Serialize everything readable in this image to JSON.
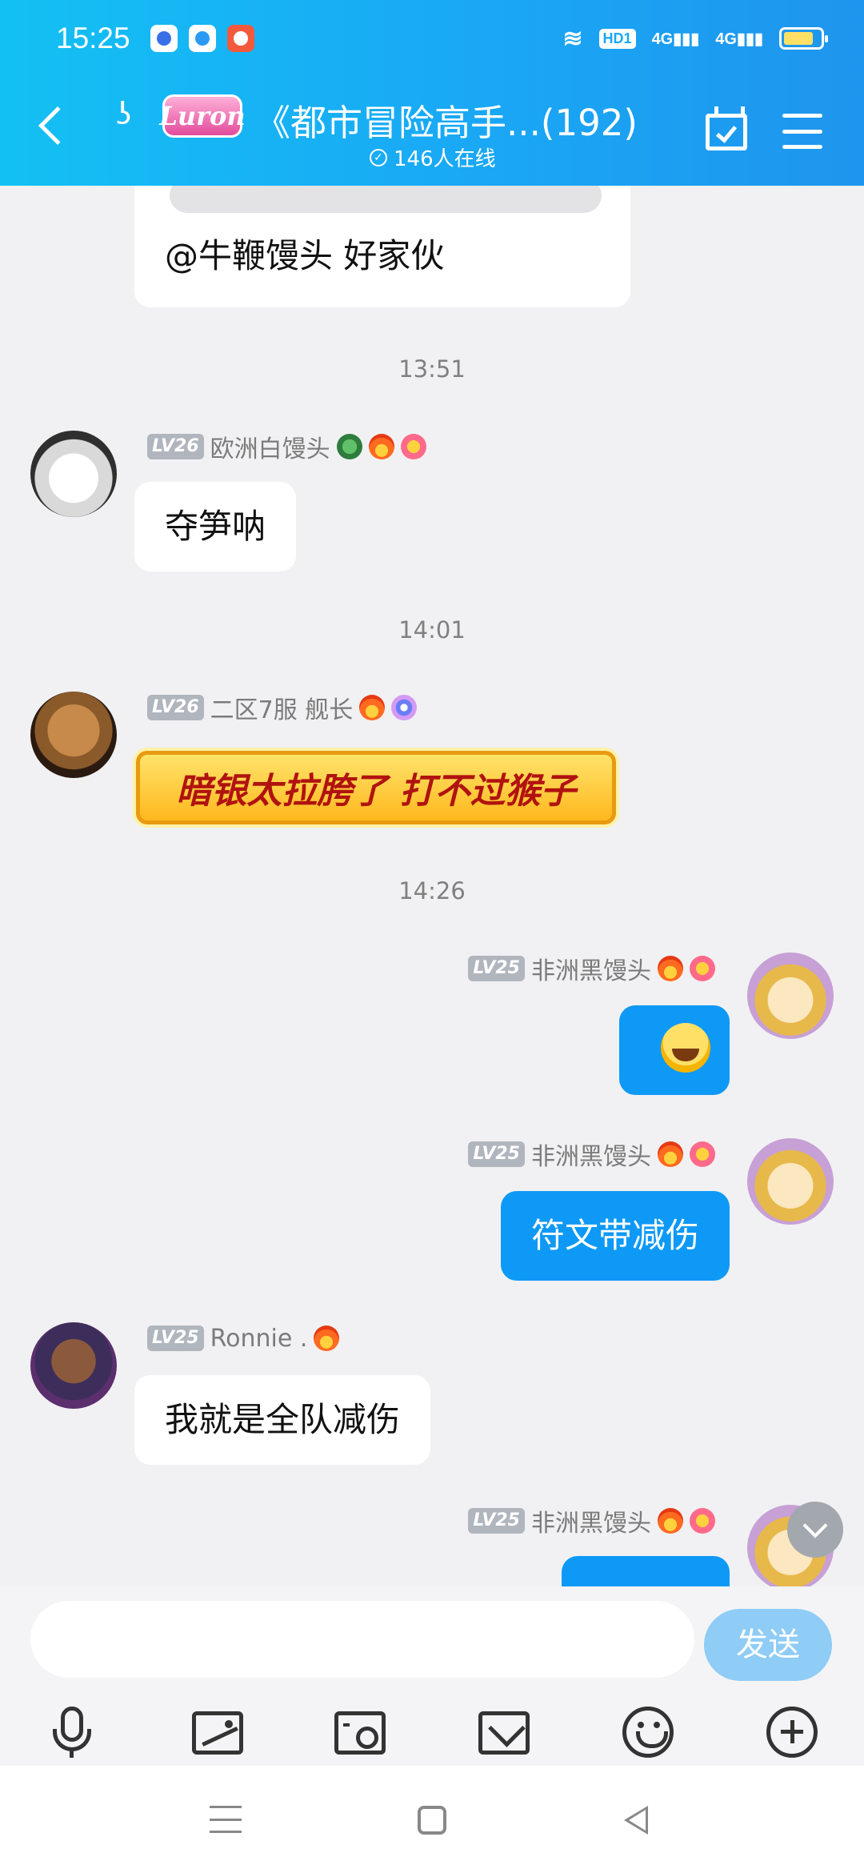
{
  "status_bar": {
    "time": "15:25",
    "hd_label": "HD1",
    "network_1": "4G",
    "network_2": "4G",
    "icons": [
      "baidu-app-icon",
      "app-icon",
      "app-icon",
      "wifi-icon",
      "signal-icon",
      "battery-icon"
    ]
  },
  "header": {
    "logo_text": "Luron",
    "title": "《都市冒险高手...(192)",
    "online": "146人在线",
    "colors": {
      "bg_start": "#13c0f3",
      "bg_end": "#1e95ee"
    }
  },
  "messages": [
    {
      "type": "text",
      "side": "left",
      "text": "@牛鞭馒头 好家伙"
    },
    {
      "type": "time",
      "text": "13:51"
    },
    {
      "type": "text",
      "side": "left",
      "level": "LV26",
      "name": "欧洲白馒头",
      "text": "夺笋呐"
    },
    {
      "type": "time",
      "text": "14:01"
    },
    {
      "type": "fancy",
      "side": "left",
      "level": "LV26",
      "name": "二区7服 舰长",
      "text": "暗银太拉胯了 打不过猴子"
    },
    {
      "type": "time",
      "text": "14:26"
    },
    {
      "type": "emoji",
      "side": "right",
      "level": "LV25",
      "name": "非洲黑馒头",
      "emoji": "laughing-tears-emoji"
    },
    {
      "type": "text",
      "side": "right",
      "level": "LV25",
      "name": "非洲黑馒头",
      "text": "符文带减伤"
    },
    {
      "type": "text",
      "side": "left",
      "level": "LV25",
      "name": "Ronnie .",
      "text": "我就是全队减伤"
    },
    {
      "type": "partial",
      "side": "right",
      "level": "LV25",
      "name": "非洲黑馒头"
    }
  ],
  "input": {
    "placeholder": "",
    "send_label": "发送"
  },
  "toolbar": [
    "microphone-icon",
    "image-icon",
    "camera-icon",
    "envelope-icon",
    "emoji-icon",
    "add-icon"
  ],
  "accent": "#0f99f6"
}
